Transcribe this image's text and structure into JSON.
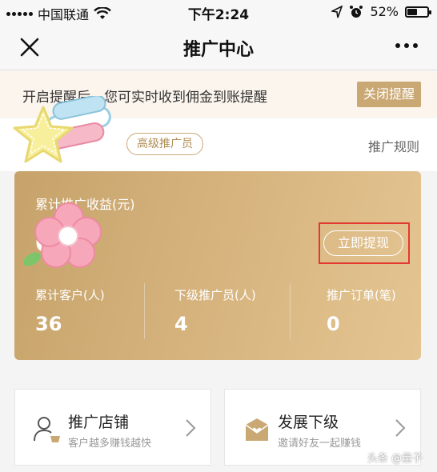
{
  "status_bar": {
    "carrier": "中国联通",
    "time": "下午2:24",
    "battery_percent": "52%",
    "battery_level": 0.52
  },
  "nav": {
    "title": "推广中心"
  },
  "notice": {
    "text": "开启提醒后，您可实时收到佣金到账提醒",
    "button": "关闭提醒"
  },
  "user": {
    "name_fragment": "...",
    "level_badge": "高级推广员",
    "rules_link": "推广规则"
  },
  "income_card": {
    "label": "累计推广收益(元)",
    "amount": "0",
    "withdraw_button": "立即提现",
    "stats": [
      {
        "label": "累计客户(人)",
        "value": "36"
      },
      {
        "label": "下级推广员(人)",
        "value": "4"
      },
      {
        "label": "推广订单(笔)",
        "value": "0"
      }
    ]
  },
  "tiles": [
    {
      "title": "推广店铺",
      "subtitle": "客户越多赚钱越快",
      "icon": "user-shop-icon"
    },
    {
      "title": "发展下级",
      "subtitle": "邀请好友一起赚钱",
      "icon": "heart-envelope-icon"
    }
  ],
  "watermark": "头条 @量子",
  "colors": {
    "gold": "#c9a874",
    "highlight_red": "#e23a2f"
  }
}
